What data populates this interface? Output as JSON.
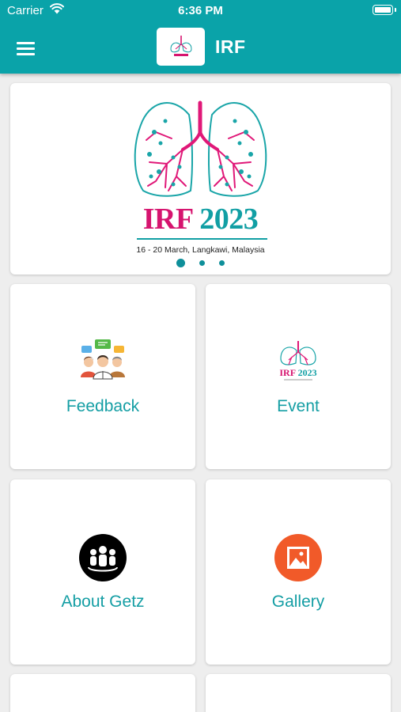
{
  "status_bar": {
    "carrier": "Carrier",
    "time": "6:36 PM"
  },
  "app_bar": {
    "title": "IRF",
    "menu_icon": "hamburger-menu-icon"
  },
  "banner": {
    "title_part1": "IRF",
    "title_part2": "2023",
    "subtitle": "16 - 20 March, Langkawi, Malaysia",
    "page_count": 3,
    "active_page": 1,
    "colors": {
      "brand_pink": "#d6146f",
      "brand_teal": "#119fa4"
    }
  },
  "tiles": [
    {
      "label": "Feedback",
      "icon": "feedback-people-icon"
    },
    {
      "label": "Event",
      "icon": "irf-event-logo-icon"
    },
    {
      "label": "About Getz",
      "icon": "group-people-icon"
    },
    {
      "label": "Gallery",
      "icon": "image-gallery-icon"
    }
  ],
  "colors": {
    "appbar": "#0aa3a9",
    "tile_label": "#149ea4",
    "gallery_icon_bg": "#f15a29",
    "about_icon_bg": "#000000"
  }
}
